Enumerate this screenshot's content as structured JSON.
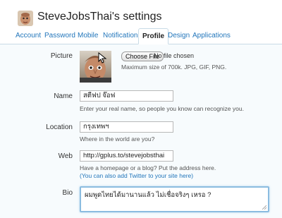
{
  "header": {
    "title": "SteveJobsThai's settings"
  },
  "tabs": [
    {
      "label": "Account"
    },
    {
      "label": "Password"
    },
    {
      "label": "Mobile"
    },
    {
      "label": "Notifications"
    },
    {
      "label": "Profile",
      "active": true
    },
    {
      "label": "Design"
    },
    {
      "label": "Applications"
    }
  ],
  "picture": {
    "label": "Picture",
    "choose_button": "Choose File",
    "file_status": "No file chosen",
    "hint": "Maximum size of 700k. JPG, GIF, PNG."
  },
  "name": {
    "label": "Name",
    "value": "สตีฟป จ๊อฟ",
    "hint": "Enter your real name, so people you know can recognize you."
  },
  "location": {
    "label": "Location",
    "value": "กรุงเทพฯ",
    "hint": "Where in the world are you?"
  },
  "web": {
    "label": "Web",
    "value": "http://gplus.to/stevejobsthai",
    "hint": "Have a homepage or a blog? Put the address here.",
    "link": "(You can also add Twitter to your site here)"
  },
  "bio": {
    "label": "Bio",
    "value": "ผมพูดไทยได้มานานแล้ว ไม่เชื่อจริงๆ เหรอ ?"
  },
  "colors": {
    "link": "#2276bb",
    "tab_border": "#c9dbe6",
    "content_bg": "#f7fbfd",
    "focus_border": "#8bbce0"
  }
}
